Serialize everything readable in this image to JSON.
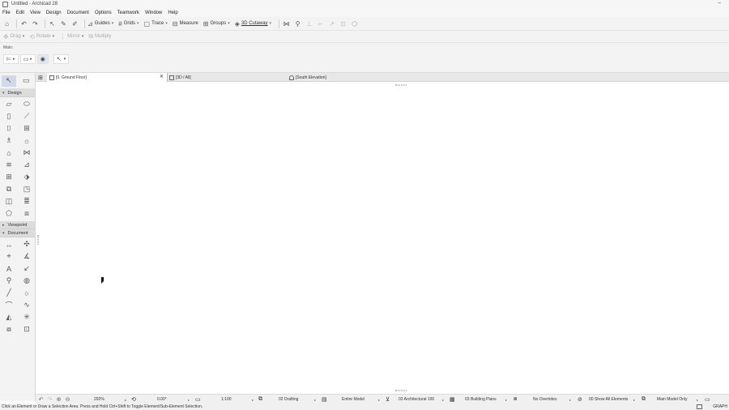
{
  "window": {
    "title": "Untitled - Archicad 28",
    "minimize_glyph": "–"
  },
  "menu": [
    "File",
    "Edit",
    "View",
    "Design",
    "Document",
    "Options",
    "Teamwork",
    "Window",
    "Help"
  ],
  "toolbar": {
    "icons": [
      "home-icon",
      "undo-icon",
      "redo-icon",
      "pointer-icon",
      "pen-icon",
      "eyedropper-icon"
    ],
    "guides": "Guides",
    "grids": "Grids",
    "trace": "Trace",
    "measure": "Measure",
    "groups": "Groups",
    "cutaway": "3D Cutaway"
  },
  "edit_toolbar": {
    "drag": "Drag",
    "rotate": "Rotate",
    "mirror": "Mirror",
    "multiply": "Multiply"
  },
  "infobox": {
    "label": "Main:"
  },
  "toolbox": {
    "groups": {
      "design": "Design",
      "viewpoint": "Viewpoint",
      "document": "Document"
    }
  },
  "tabs": [
    {
      "label": "[0. Ground Floor]",
      "close": "✕"
    },
    {
      "label": "[3D / All]"
    },
    {
      "label": "[South Elevation]"
    }
  ],
  "status": {
    "zoom": "292%",
    "angle": "0.00°",
    "scale": "1:100",
    "layer_combo": "02 Drafting",
    "model_view": "Entire Model",
    "mvo": "03 Architectural 100",
    "layer_set": "03 Building Plans",
    "overrides": "No Overrides",
    "renovation": "00 Show All Elements",
    "model_only": "Main Model Only"
  },
  "hint": {
    "text": "Click an Element or Draw a Selection Area. Press and Hold Ctrl+Shift to Toggle Element/Sub-Element Selection.",
    "graph": "GRAPH"
  }
}
